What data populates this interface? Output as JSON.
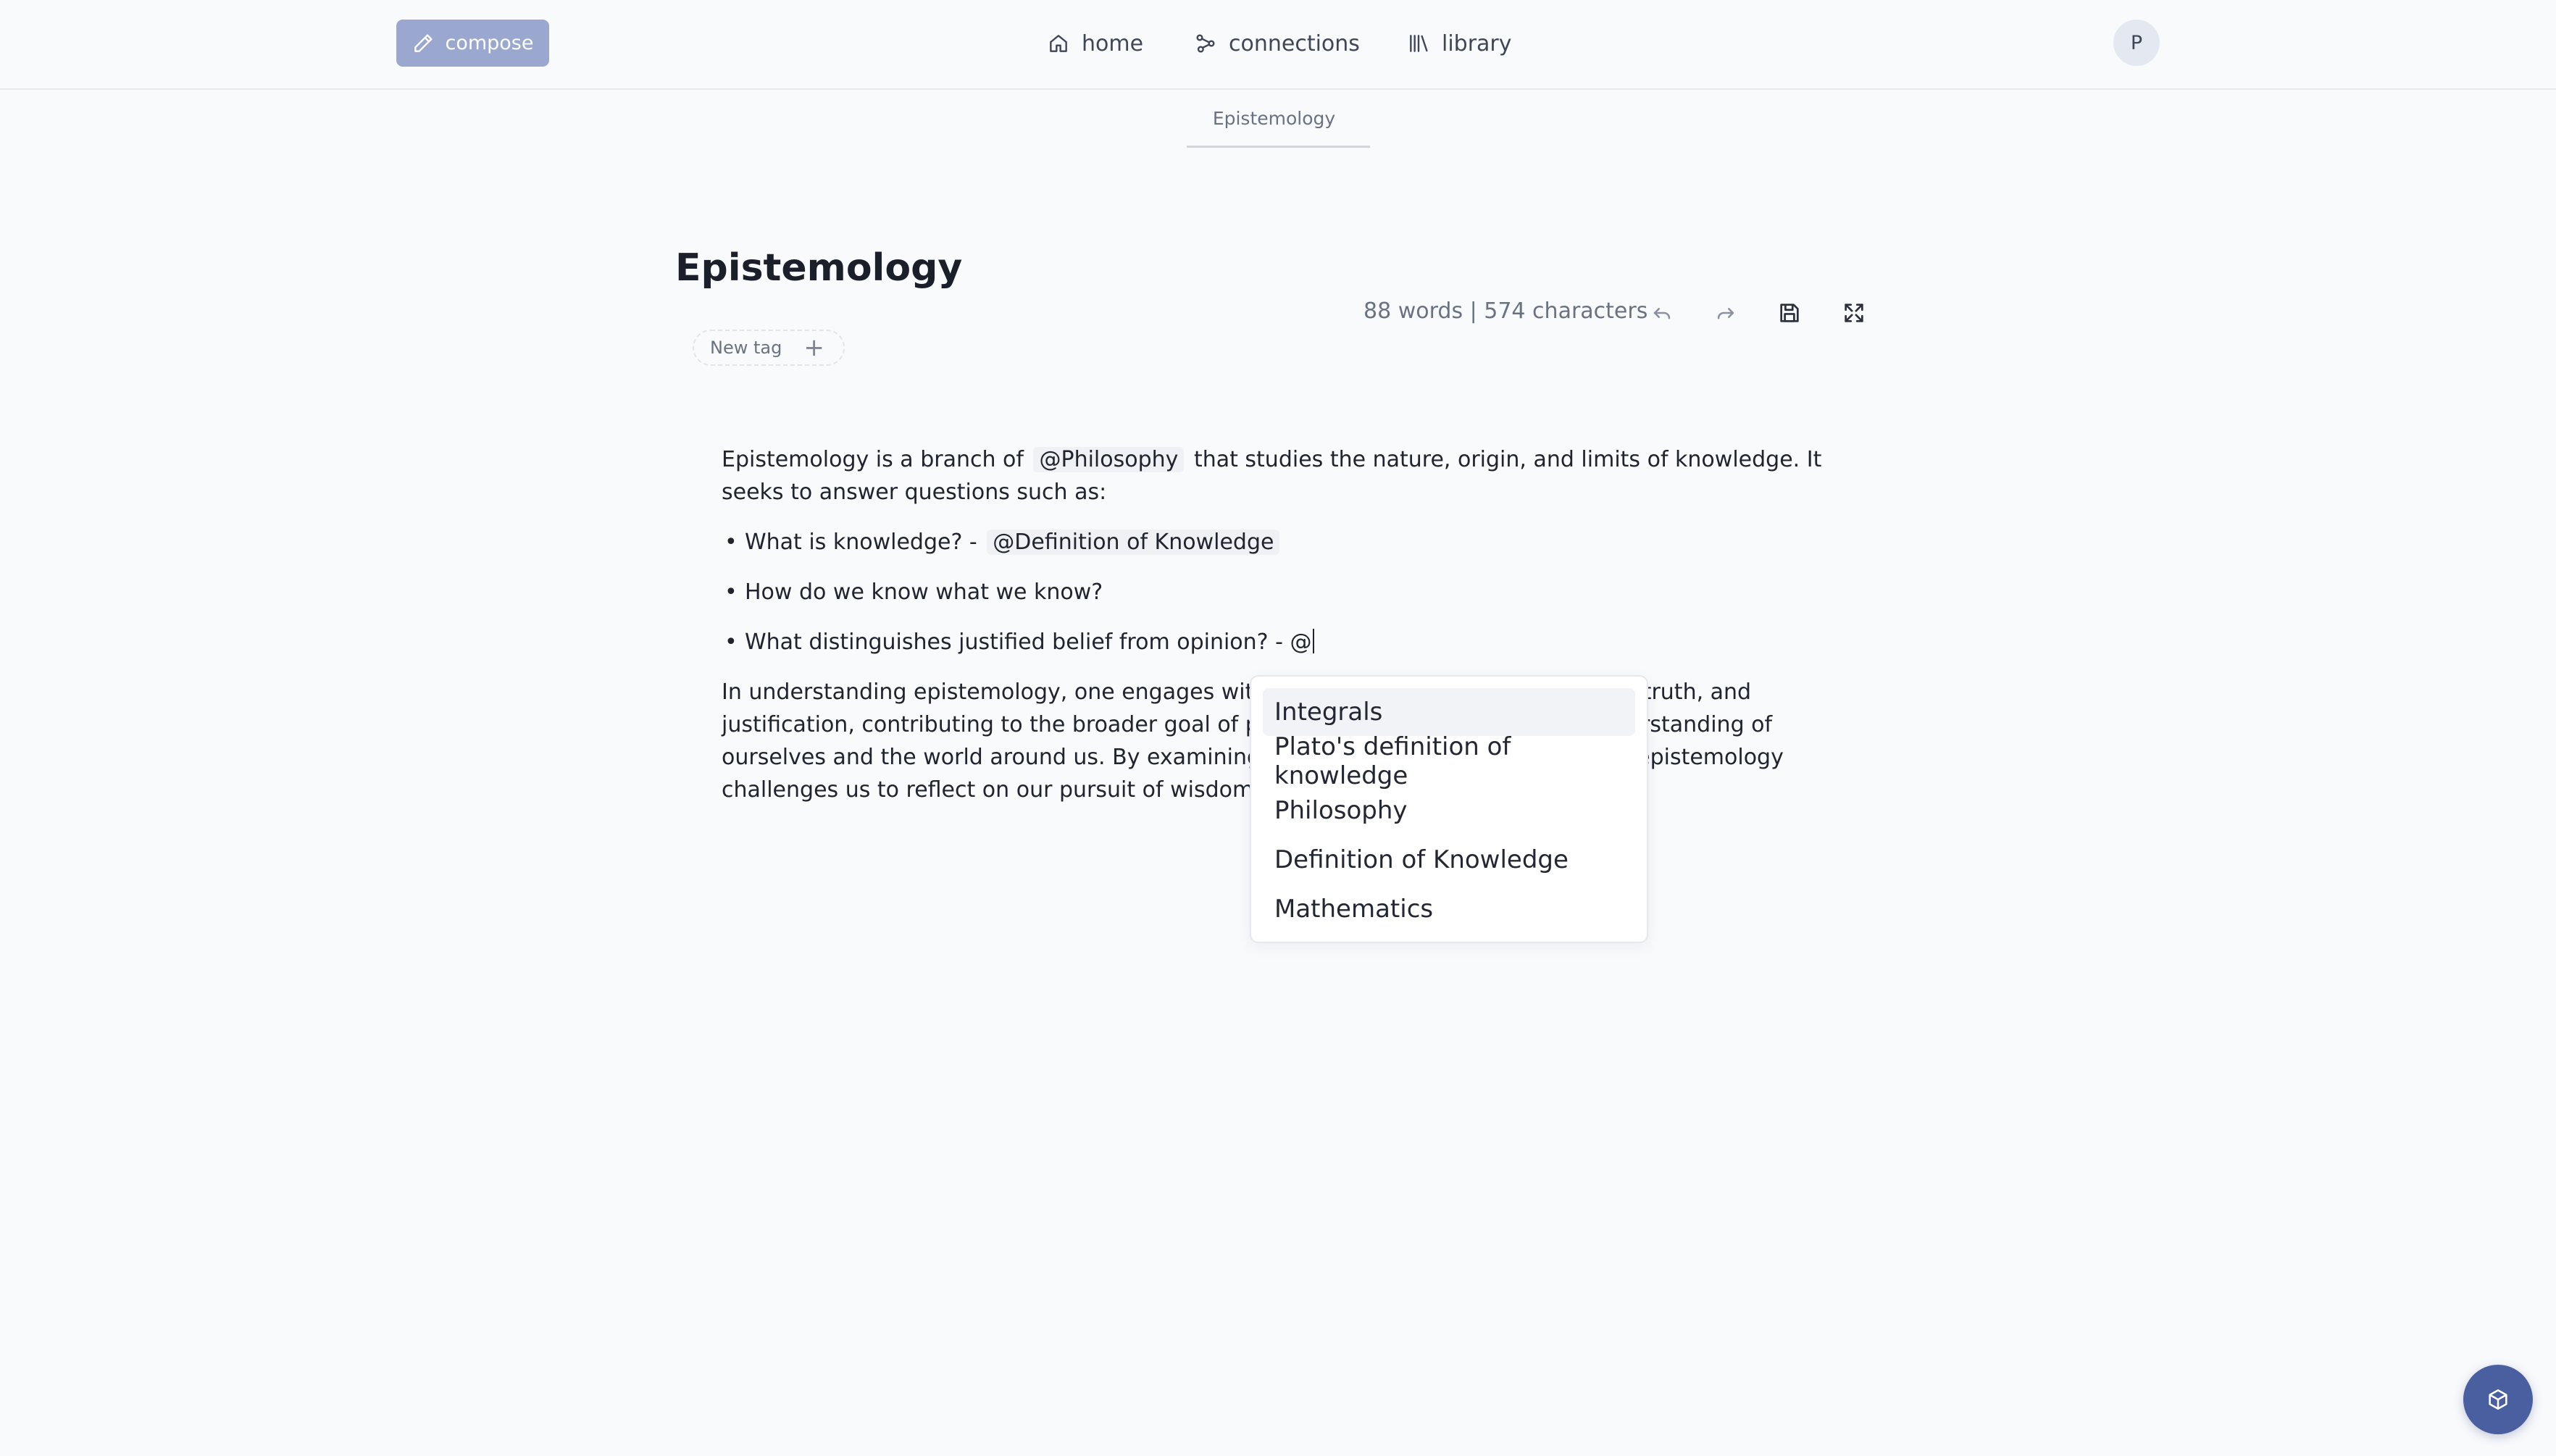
{
  "header": {
    "compose_label": "compose",
    "nav": [
      {
        "label": "home",
        "icon": "home-icon"
      },
      {
        "label": "connections",
        "icon": "connections-icon"
      },
      {
        "label": "library",
        "icon": "library-icon"
      }
    ],
    "avatar_initial": "P"
  },
  "tabs": [
    {
      "label": "Epistemology"
    }
  ],
  "document": {
    "title": "Epistemology",
    "new_tag_label": "New tag",
    "stats": "88 words | 574 characters",
    "toolbar_icons": [
      "undo-icon",
      "redo-icon",
      "save-icon",
      "fullscreen-icon"
    ],
    "paragraph1_text": "Epistemology is a branch of ",
    "paragraph1_mention": "@Philosophy",
    "paragraph1_rest": " that studies the nature, origin, and limits of knowledge. It seeks to answer questions such as:",
    "bullets": [
      {
        "text": "What is knowledge? - ",
        "mention": "@Definition of Knowledge"
      },
      {
        "text": "How do we know what we know?"
      },
      {
        "text": "What distinguishes justified belief from opinion? - ",
        "typing": "@"
      }
    ],
    "paragraph2": "In understanding epistemology, one engages with fundamental concepts like belief, truth, and justification, contributing to the broader goal of philosophical inquiry: a deeper understanding of ourselves and the world around us. By examining our beliefs and their foundations, epistemology challenges us to reflect on our pursuit of wisdom"
  },
  "mention_suggestions": [
    "Integrals",
    "Plato's definition of knowledge",
    "Philosophy",
    "Definition of Knowledge",
    "Mathematics"
  ],
  "colors": {
    "background": "#f9fafc",
    "compose_button": "#9aa8cf",
    "fab": "#4a5fa0",
    "text": "#20242f",
    "muted_text": "#6a7282"
  },
  "fab_icon": "cube-icon"
}
